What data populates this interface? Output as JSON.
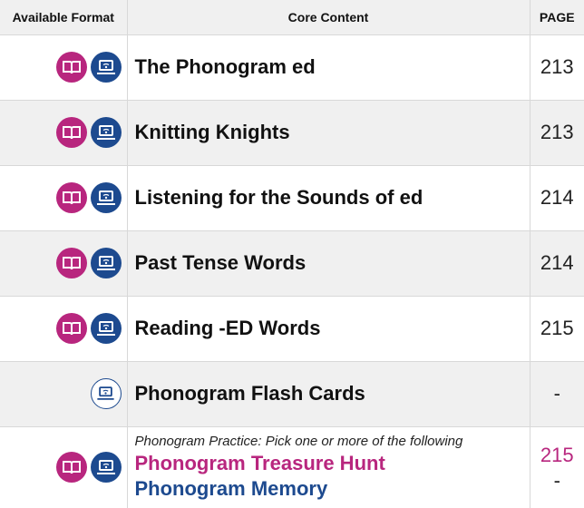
{
  "header": {
    "format_label": "Available Format",
    "content_label": "Core Content",
    "page_label": "PAGE"
  },
  "rows": [
    {
      "title": "The Phonogram ed",
      "page": "213",
      "formats": [
        "book-icon",
        "laptop-icon"
      ]
    },
    {
      "title": "Knitting Knights",
      "page": "213",
      "formats": [
        "book-icon",
        "laptop-icon"
      ]
    },
    {
      "title": "Listening for the Sounds of ed",
      "page": "214",
      "formats": [
        "book-icon",
        "laptop-icon"
      ]
    },
    {
      "title": "Past Tense Words",
      "page": "214",
      "formats": [
        "book-icon",
        "laptop-icon"
      ]
    },
    {
      "title": "Reading -ED Words",
      "page": "215",
      "formats": [
        "book-icon",
        "laptop-icon"
      ]
    },
    {
      "title": "Phonogram Flash Cards",
      "page": "-",
      "formats": [
        "laptop-icon"
      ]
    }
  ],
  "practice": {
    "intro": "Phonogram Practice: Pick one or more of the following",
    "option1": "Phonogram Treasure Hunt",
    "option2": "Phonogram Memory",
    "page1": "215",
    "page2": "-",
    "formats": [
      "book-icon",
      "laptop-icon"
    ]
  },
  "colors": {
    "book": "#b8267e",
    "laptop": "#1d4a8f",
    "header_bg": "#f0f0f0"
  }
}
